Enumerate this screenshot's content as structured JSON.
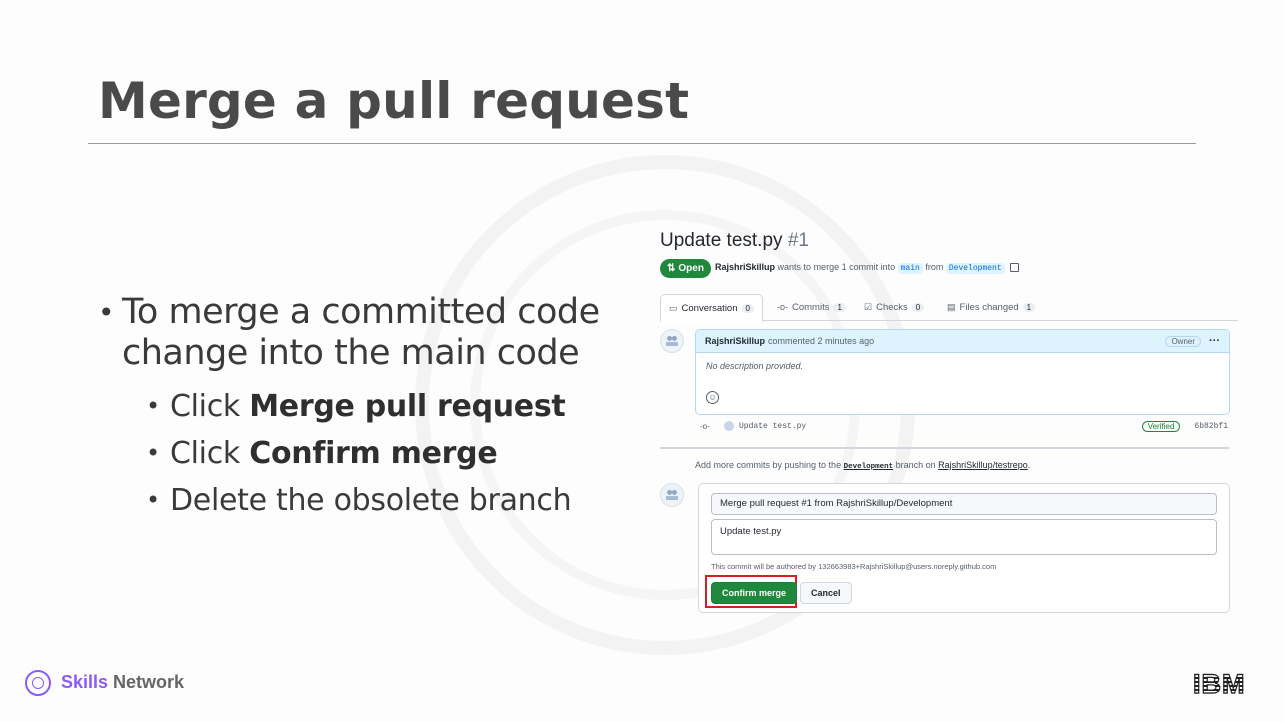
{
  "slide": {
    "title": "Merge a pull request",
    "bullets": [
      {
        "text": "To merge a committed code change into the main code",
        "sub": [
          {
            "prefix": "Click ",
            "bold": "Merge pull request"
          },
          {
            "prefix": "Click ",
            "bold": "Confirm merge"
          },
          {
            "prefix": "Delete the obsolete branch",
            "bold": ""
          }
        ]
      }
    ]
  },
  "pr": {
    "title": "Update test.py",
    "number": "#1",
    "status": "Open",
    "author": "RajshriSkillup",
    "meta_text": "wants to merge 1 commit into",
    "base_branch": "main",
    "from_text": "from",
    "head_branch": "Development",
    "tabs": [
      {
        "label": "Conversation",
        "count": "0",
        "icon": "conversation-icon"
      },
      {
        "label": "Commits",
        "count": "1",
        "icon": "commit-icon"
      },
      {
        "label": "Checks",
        "count": "0",
        "icon": "checks-icon"
      },
      {
        "label": "Files changed",
        "count": "1",
        "icon": "file-diff-icon"
      }
    ],
    "comment": {
      "author": "RajshriSkillup",
      "time": "commented 2 minutes ago",
      "role": "Owner",
      "body": "No description provided."
    },
    "commit": {
      "message": "Update test.py",
      "verified": "Verified",
      "sha": "6b82bf1"
    },
    "add_more": {
      "prefix": "Add more commits by pushing to the",
      "branch": "Development",
      "middle": "branch on",
      "repo": "RajshriSkillup/testrepo",
      "suffix": "."
    },
    "merge": {
      "commit_title": "Merge pull request #1 from RajshriSkillup/Development",
      "commit_body": "Update test.py",
      "author_note": "This commit will be authored by 132663983+RajshriSkillup@users.noreply.github.com",
      "confirm_label": "Confirm merge",
      "cancel_label": "Cancel"
    }
  },
  "footer": {
    "brand_bold": "Skills",
    "brand_rest": " Network",
    "company_logo": "IBM"
  },
  "colors": {
    "accent_green": "#1f883d",
    "highlight_red": "#d62020",
    "brand_purple": "#8a5cf6"
  }
}
